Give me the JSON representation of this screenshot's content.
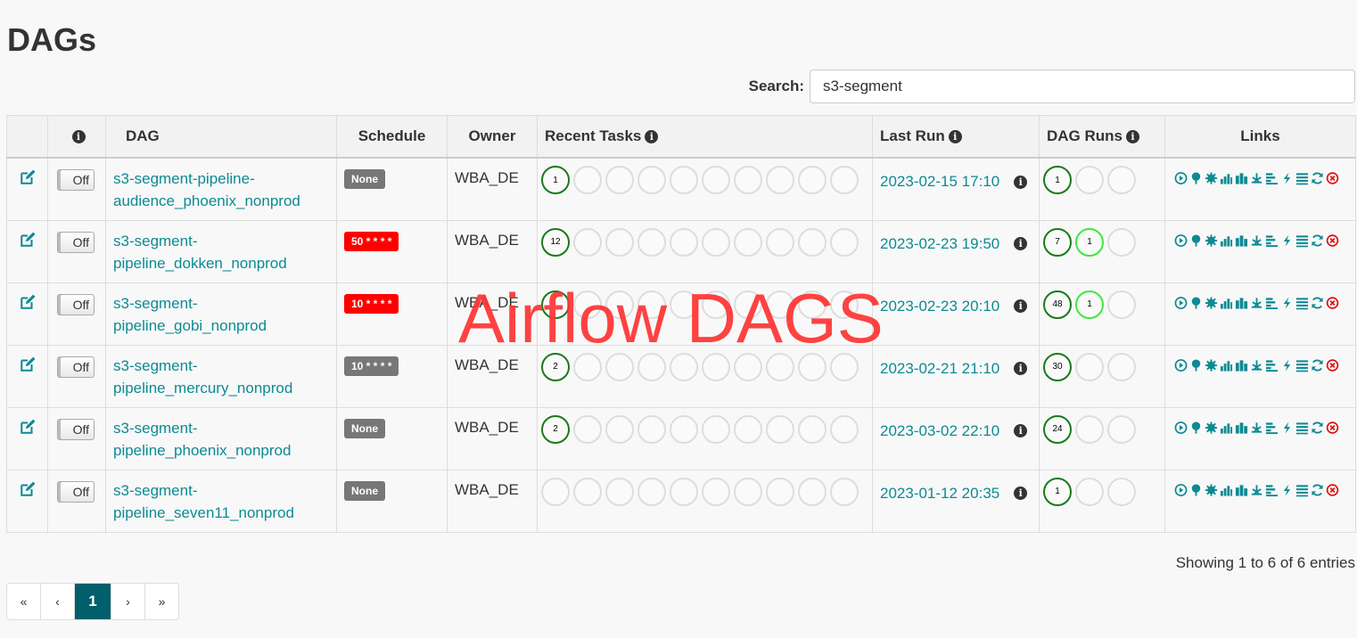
{
  "page": {
    "title": "DAGs"
  },
  "search": {
    "label": "Search:",
    "value": "s3-segment"
  },
  "table": {
    "headers": {
      "dag": "DAG",
      "schedule": "Schedule",
      "owner": "Owner",
      "recent_tasks": "Recent Tasks",
      "last_run": "Last Run",
      "dag_runs": "DAG Runs",
      "links": "Links"
    },
    "rows": [
      {
        "toggle": "Off",
        "dag_line1": "s3-segment-pipeline-",
        "dag_line2": "audience_phoenix_nonprod",
        "schedule": "None",
        "schedule_color": "#777777",
        "owner": "WBA_DE",
        "recent_tasks": [
          {
            "n": "1",
            "state": "success"
          },
          {},
          {},
          {},
          {},
          {},
          {},
          {},
          {},
          {}
        ],
        "last_run": "2023-02-15 17:10",
        "dag_runs": [
          {
            "n": "1",
            "state": "success"
          },
          {},
          {}
        ]
      },
      {
        "toggle": "Off",
        "dag_line1": "s3-segment-",
        "dag_line2": "pipeline_dokken_nonprod",
        "schedule": "50 * * * *",
        "schedule_color": "#ff0000",
        "owner": "WBA_DE",
        "recent_tasks": [
          {
            "n": "12",
            "state": "success"
          },
          {},
          {},
          {},
          {},
          {},
          {},
          {},
          {},
          {}
        ],
        "last_run": "2023-02-23 19:50",
        "dag_runs": [
          {
            "n": "7",
            "state": "success"
          },
          {
            "n": "1",
            "state": "running"
          },
          {}
        ]
      },
      {
        "toggle": "Off",
        "dag_line1": "s3-segment-",
        "dag_line2": "pipeline_gobi_nonprod",
        "schedule": "10 * * * *",
        "schedule_color": "#ff0000",
        "owner": "WBA_DE",
        "recent_tasks": [
          {
            "n": "",
            "state": "success"
          },
          {},
          {},
          {},
          {},
          {},
          {},
          {},
          {},
          {}
        ],
        "last_run": "2023-02-23 20:10",
        "dag_runs": [
          {
            "n": "48",
            "state": "success"
          },
          {
            "n": "1",
            "state": "running"
          },
          {}
        ]
      },
      {
        "toggle": "Off",
        "dag_line1": "s3-segment-",
        "dag_line2": "pipeline_mercury_nonprod",
        "schedule": "10 * * * *",
        "schedule_color": "#777777",
        "owner": "WBA_DE",
        "recent_tasks": [
          {
            "n": "2",
            "state": "success"
          },
          {},
          {},
          {},
          {},
          {},
          {},
          {},
          {},
          {}
        ],
        "last_run": "2023-02-21 21:10",
        "dag_runs": [
          {
            "n": "30",
            "state": "success"
          },
          {},
          {}
        ]
      },
      {
        "toggle": "Off",
        "dag_line1": "s3-segment-",
        "dag_line2": "pipeline_phoenix_nonprod",
        "schedule": "None",
        "schedule_color": "#777777",
        "owner": "WBA_DE",
        "recent_tasks": [
          {
            "n": "2",
            "state": "success"
          },
          {},
          {},
          {},
          {},
          {},
          {},
          {},
          {},
          {}
        ],
        "last_run": "2023-03-02 22:10",
        "dag_runs": [
          {
            "n": "24",
            "state": "success"
          },
          {},
          {}
        ]
      },
      {
        "toggle": "Off",
        "dag_line1": "s3-segment-",
        "dag_line2": "pipeline_seven11_nonprod",
        "schedule": "None",
        "schedule_color": "#777777",
        "owner": "WBA_DE",
        "recent_tasks": [
          {},
          {},
          {},
          {},
          {},
          {},
          {},
          {},
          {},
          {}
        ],
        "last_run": "2023-01-12 20:35",
        "dag_runs": [
          {
            "n": "1",
            "state": "success"
          },
          {},
          {}
        ]
      }
    ],
    "link_icons": [
      "trigger-dag-icon",
      "tree-view-icon",
      "graph-view-icon",
      "task-duration-icon",
      "task-tries-icon",
      "landing-times-icon",
      "gantt-icon",
      "code-icon",
      "logs-icon",
      "refresh-icon",
      "delete-icon"
    ],
    "accent_color": "#0d8a93"
  },
  "footer": {
    "showing": "Showing 1 to 6 of 6 entries"
  },
  "pagination": {
    "first": "«",
    "prev": "‹",
    "current": "1",
    "next": "›",
    "last": "»"
  },
  "watermark": "Airflow DAGS"
}
